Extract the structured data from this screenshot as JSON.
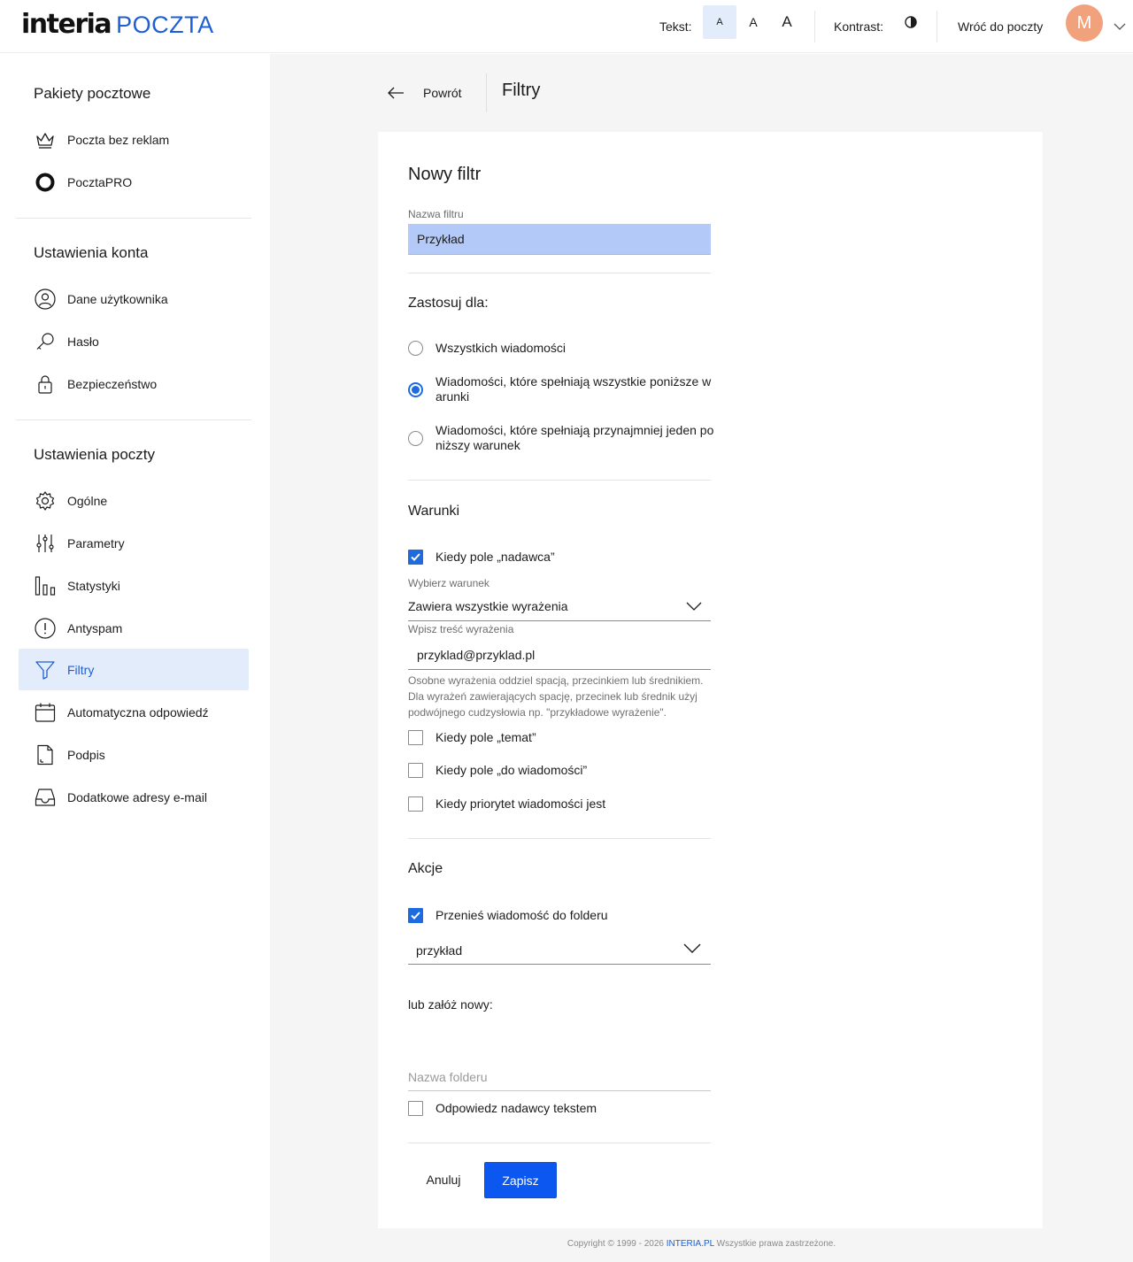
{
  "header": {
    "logo_brand": "interia",
    "logo_product": "POCZTA",
    "text_size_label": "Tekst:",
    "text_sizes": [
      "A",
      "A",
      "A"
    ],
    "contrast_label": "Kontrast:",
    "back_to_mail": "Wróć do poczty",
    "avatar_letter": "M",
    "avatar_color": "#f1a27c"
  },
  "sidebar": {
    "sections": [
      {
        "title": "Pakiety pocztowe",
        "items": [
          {
            "label": "Poczta bez reklam",
            "icon": "crown-icon"
          },
          {
            "label": "PocztaPRO",
            "icon": "pro-ring-icon"
          }
        ]
      },
      {
        "title": "Ustawienia konta",
        "items": [
          {
            "label": "Dane użytkownika",
            "icon": "user-icon"
          },
          {
            "label": "Hasło",
            "icon": "key-icon"
          },
          {
            "label": "Bezpieczeństwo",
            "icon": "lock-icon"
          }
        ]
      },
      {
        "title": "Ustawienia poczty",
        "items": [
          {
            "label": "Ogólne",
            "icon": "gear-icon"
          },
          {
            "label": "Parametry",
            "icon": "sliders-icon"
          },
          {
            "label": "Statystyki",
            "icon": "bar-chart-icon"
          },
          {
            "label": "Antyspam",
            "icon": "alert-circle-icon"
          },
          {
            "label": "Filtry",
            "icon": "filter-icon",
            "active": true
          },
          {
            "label": "Automatyczna odpowiedź",
            "icon": "calendar-icon"
          },
          {
            "label": "Podpis",
            "icon": "document-icon"
          },
          {
            "label": "Dodatkowe adresy e-mail",
            "icon": "inbox-icon"
          }
        ]
      }
    ]
  },
  "main": {
    "back_label": "Powrót",
    "page_title": "Filtry",
    "form": {
      "title": "Nowy filtr",
      "name_label": "Nazwa filtru",
      "name_value": "Przykład",
      "apply_title": "Zastosuj dla:",
      "apply_options": [
        {
          "label": "Wszystkich wiadomości",
          "selected": false
        },
        {
          "label_line1": "Wiadomości, które spełniają wszystkie poniższe w",
          "label_line2": "arunki",
          "selected": true
        },
        {
          "label_line1": "Wiadomości, które spełniają przynajmniej jeden po",
          "label_line2": "niższy warunek",
          "selected": false
        }
      ],
      "conditions_title": "Warunki",
      "cond_sender_label": "Kiedy pole „nadawca”",
      "cond_sender_checked": true,
      "select_condition_label": "Wybierz warunek",
      "select_condition_value": "Zawiera wszystkie wyrażenia",
      "expression_label": "Wpisz treść wyrażenia",
      "expression_value": "przyklad@przyklad.pl",
      "help_text_1": "Osobne wyrażenia oddziel spacją, przecinkiem lub średnikiem.",
      "help_text_2": "Dla wyrażeń zawierających spację, przecinek lub średnik użyj",
      "help_text_3": "podwójnego cudzysłowia np. \"przykładowe wyrażenie\".",
      "cond_subject_label": "Kiedy pole „temat”",
      "cond_to_label": "Kiedy pole „do wiadomości”",
      "cond_priority_label": "Kiedy priorytet wiadomości jest",
      "actions_title": "Akcje",
      "action_move_label": "Przenieś wiadomość do folderu",
      "action_move_checked": true,
      "folder_value": "przykład",
      "or_create_label": "lub załóż nowy:",
      "folder_name_placeholder": "Nazwa folderu",
      "reply_label": "Odpowiedz nadawcy tekstem",
      "cancel_label": "Anuluj",
      "save_label": "Zapisz"
    },
    "footer": {
      "prefix": "Copyright © 1999 - 2026 ",
      "brand": "INTERIA.PL",
      "suffix": " Wszystkie prawa zastrzeżone."
    }
  },
  "colors": {
    "accent": "#1e6be0",
    "primary_button": "#0b57f0",
    "active_bg": "#e3ecfb",
    "input_highlight": "#b3c9f8"
  }
}
